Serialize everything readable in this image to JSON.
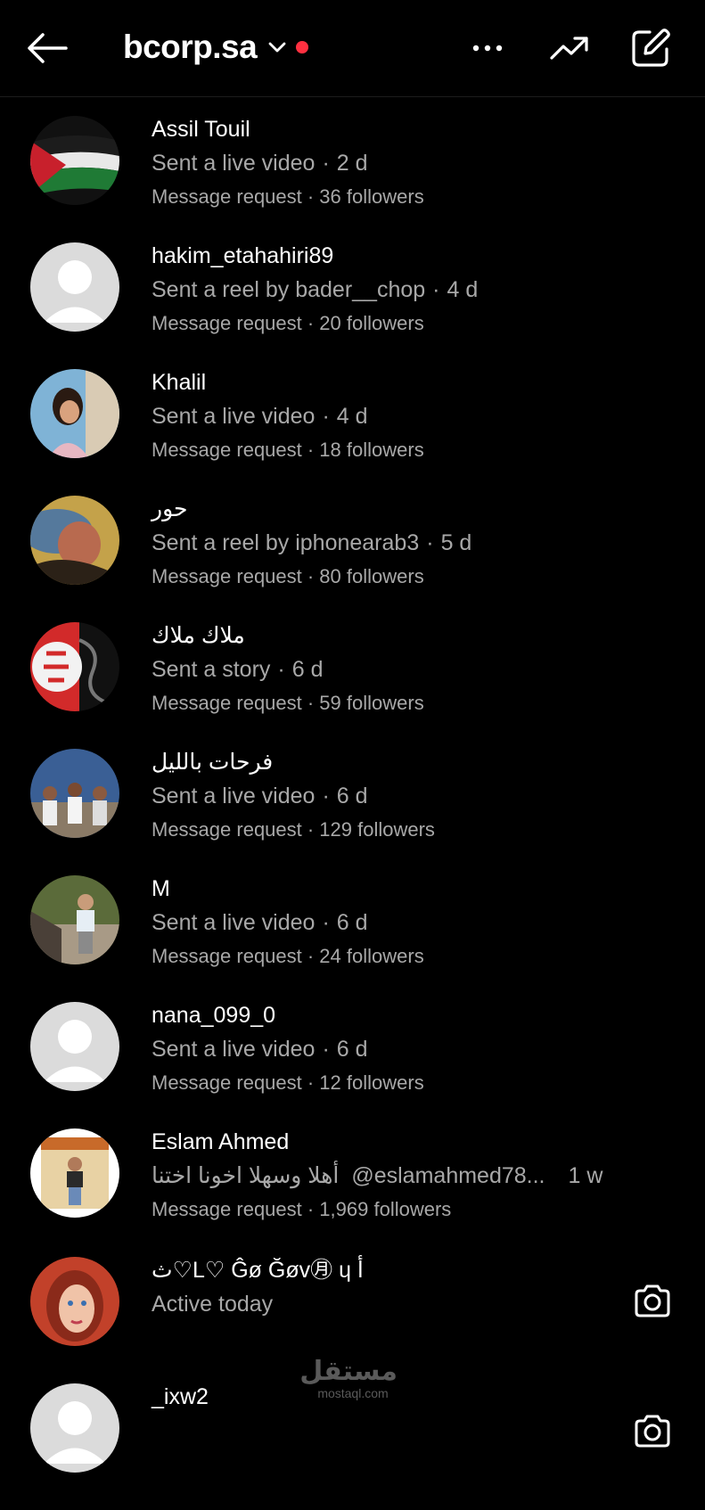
{
  "header": {
    "title": "bcorp.sa",
    "unread_dot_color": "#ff3040",
    "icons": [
      "back-arrow-icon",
      "chevron-down-icon",
      "more-icon",
      "trending-icon",
      "compose-icon"
    ]
  },
  "threads": [
    {
      "name": "Assil Touil",
      "preview": "Sent a live video",
      "time": "2 d",
      "meta": "Message request · 36 followers"
    },
    {
      "name": "hakim_etahahiri89",
      "preview": "Sent a reel by bader__chop",
      "time": "4 d",
      "meta": "Message request · 20 followers"
    },
    {
      "name": "Khalil",
      "preview": "Sent a live video",
      "time": "4 d",
      "meta": "Message request · 18 followers"
    },
    {
      "name": "حور",
      "preview": "Sent a reel by iphonearab3",
      "time": "5 d",
      "meta": "Message request · 80 followers"
    },
    {
      "name": "ملاك ملاك",
      "preview": "Sent a story",
      "time": "6 d",
      "meta": "Message request · 59 followers"
    },
    {
      "name": "فرحات بالليل",
      "preview": "Sent a live video",
      "time": "6 d",
      "meta": "Message request · 129 followers"
    },
    {
      "name": "M",
      "preview": "Sent a live video",
      "time": "6 d",
      "meta": "Message request · 24 followers"
    },
    {
      "name": "nana_099_0",
      "preview": "Sent a live video",
      "time": "6 d",
      "meta": "Message request · 12 followers"
    },
    {
      "name": "Eslam Ahmed",
      "preview_arabic": "أهلا وسهلا اخونا اختنا",
      "preview": "@eslamahmed78...",
      "time": "1 w",
      "meta": "Message request · 1,969 followers"
    },
    {
      "name": "ث♡L♡ Ĝø Ğøv㊊ ɥ أ",
      "preview": "Active today",
      "camera": "camera-icon"
    },
    {
      "name": "_ixw2",
      "camera": "camera-icon"
    }
  ],
  "watermark": {
    "arabic": "مستقل",
    "latin": "mostaql.com"
  }
}
